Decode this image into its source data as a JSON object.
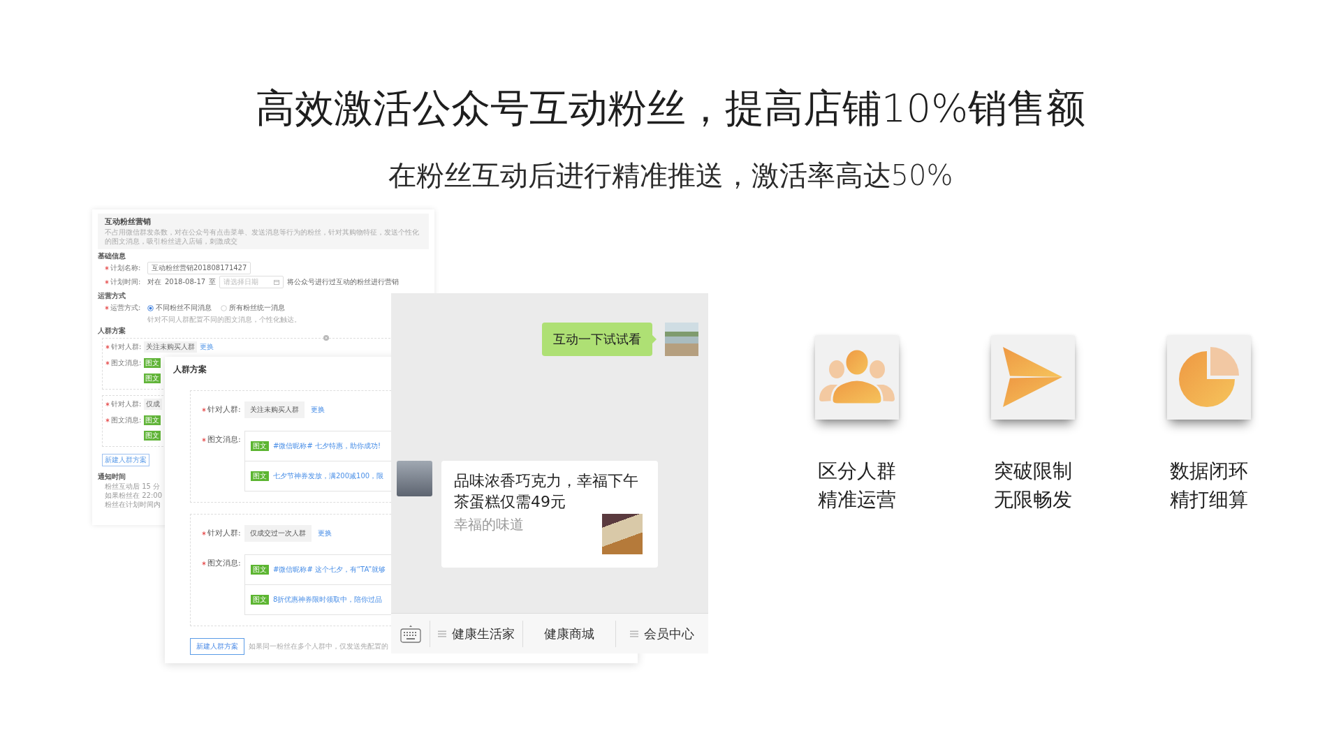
{
  "headline": "高效激活公众号互动粉丝，提高店铺10%销售额",
  "subheadline": "在粉丝互动后进行精准推送，激活率高达50%",
  "back_form": {
    "title": "互动粉丝营销",
    "description": "不占用微信群发条数，对在公众号有点击菜单、发送消息等行为的粉丝，针对其购物特征，发送个性化的图文消息，吸引粉丝进入店铺，刺激成交",
    "basic_info": {
      "heading": "基础信息",
      "plan_name": {
        "label": "计划名称:",
        "required": true,
        "value": "互动粉丝营销201808171427"
      },
      "plan_time": {
        "label": "计划时间:",
        "required": true,
        "prefix": "对在",
        "start_date": "2018-08-17",
        "separator": "至",
        "end_date": {
          "placeholder": "请选择日期"
        },
        "suffix": "将公众号进行过互动的粉丝进行营销"
      }
    },
    "operation": {
      "heading": "运营方式",
      "label": "运营方式:",
      "required": true,
      "options": [
        {
          "label": "不同粉丝不同消息",
          "selected": true
        },
        {
          "label": "所有粉丝统一消息",
          "selected": false
        }
      ],
      "hint": "针对不同人群配置不同的图文消息，个性化触达。"
    },
    "crowd_plans": {
      "heading": "人群方案",
      "plans": [
        {
          "required": true,
          "audience_label": "针对人群:",
          "audience": "关注未购买人群",
          "change_link": "更换",
          "messages_label": "图文消息:",
          "message_tags": [
            "图文",
            "图文"
          ]
        },
        {
          "required": true,
          "audience_label": "针对人群:",
          "audience": "仅成",
          "messages_label": "图文消息:",
          "message_tags": [
            "图文",
            "图文"
          ]
        }
      ],
      "new_plan_button": "新建人群方案"
    },
    "notification": {
      "heading": "通知时间",
      "lines": [
        "粉丝互动后 15 分",
        "如果粉丝在 22:00",
        "粉丝在计划时间内"
      ]
    }
  },
  "crowd_card": {
    "title": "人群方案",
    "plans": [
      {
        "required": true,
        "audience_label": "针对人群:",
        "audience": "关注未购买人群",
        "change_link": "更换",
        "messages_label": "图文消息:",
        "messages": [
          {
            "tag": "图文",
            "text": "#微信昵称# 七夕特惠，助你成功!"
          },
          {
            "tag": "图文",
            "text": "七夕节神券发放，满200减100，限"
          }
        ]
      },
      {
        "required": true,
        "audience_label": "针对人群:",
        "audience": "仅成交过一次人群",
        "change_link": "更换",
        "messages_label": "图文消息:",
        "messages": [
          {
            "tag": "图文",
            "text": "#微信昵称# 这个七夕，有“TA”就够"
          },
          {
            "tag": "图文",
            "text": "8折优惠神券限时领取中，陪你过品"
          }
        ]
      }
    ],
    "new_plan_button": "新建人群方案",
    "note": "如果同一粉丝在多个人群中，仅发送先配置的"
  },
  "chat": {
    "messages": [
      {
        "kind": "text",
        "outgoing": true,
        "text": "互动一下试试看"
      },
      {
        "kind": "article",
        "outgoing": false,
        "title": "品味浓香巧克力，幸福下午茶蛋糕仅需49元",
        "summary": "幸福的味道"
      }
    ],
    "menu": [
      {
        "label": "健康生活家",
        "submenu": true
      },
      {
        "label": "健康商城",
        "submenu": false
      },
      {
        "label": "会员中心",
        "submenu": true
      }
    ]
  },
  "features": [
    {
      "kind": "people",
      "lines": [
        "区分人群",
        "精准运营"
      ]
    },
    {
      "kind": "send",
      "lines": [
        "突破限制",
        "无限畅发"
      ]
    },
    {
      "kind": "pie",
      "lines": [
        "数据闭环",
        "精打细算"
      ]
    }
  ]
}
